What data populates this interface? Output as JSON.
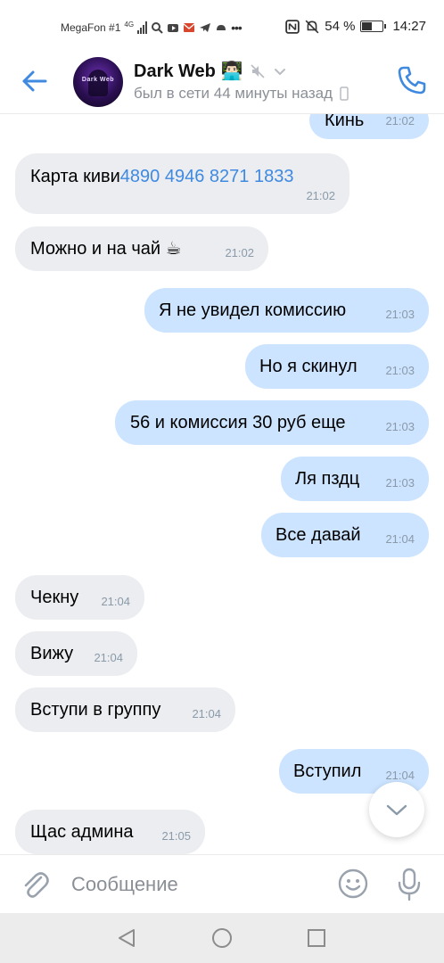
{
  "status_bar": {
    "carrier": "MegaFon #1",
    "network": "4G",
    "battery": "54 %",
    "battery_level": 0.54,
    "time": "14:27"
  },
  "header": {
    "name": "Dark Web 👨🏻‍💻",
    "status": "был в сети 44 минуты назад",
    "avatar_text": "Dark Web",
    "icons": [
      "back-arrow-icon",
      "muted-icon",
      "chevron-down-icon",
      "mobile-icon",
      "phone-icon"
    ]
  },
  "messages": [
    {
      "dir": "out",
      "text": "Кинь",
      "time": "21:02"
    },
    {
      "dir": "in",
      "text": "Карта киви ",
      "link": "4890 4946 8271 1833",
      "time": "21:02"
    },
    {
      "dir": "in",
      "text": "Можно и на чай ☕",
      "time": "21:02"
    },
    {
      "dir": "out",
      "text": "Я не увидел комиссию",
      "time": "21:03"
    },
    {
      "dir": "out",
      "text": "Но я скинул",
      "time": "21:03"
    },
    {
      "dir": "out",
      "text": "56 и комиссия 30 руб еще",
      "time": "21:03"
    },
    {
      "dir": "out",
      "text": "Ля пздц",
      "time": "21:03"
    },
    {
      "dir": "out",
      "text": "Все давай",
      "time": "21:04"
    },
    {
      "dir": "in",
      "text": "Чекну",
      "time": "21:04"
    },
    {
      "dir": "in",
      "text": "Вижу",
      "time": "21:04"
    },
    {
      "dir": "in",
      "text": "Вступи в группу",
      "time": "21:04"
    },
    {
      "dir": "out",
      "text": "Вступил",
      "time": "21:04"
    },
    {
      "dir": "in",
      "text": "Щас админа",
      "time": "21:05"
    }
  ],
  "composer": {
    "placeholder": "Сообщение",
    "icons": [
      "attach-icon",
      "emoji-icon",
      "microphone-icon",
      "scroll-down-icon"
    ]
  },
  "nav": [
    "back-nav-icon",
    "home-nav-icon",
    "recents-nav-icon"
  ],
  "colors": {
    "accent": "#3f8ae0",
    "incoming_bubble": "#ebedf0",
    "outgoing_bubble": "#cce4ff",
    "time_text": "#8a9aa9"
  }
}
